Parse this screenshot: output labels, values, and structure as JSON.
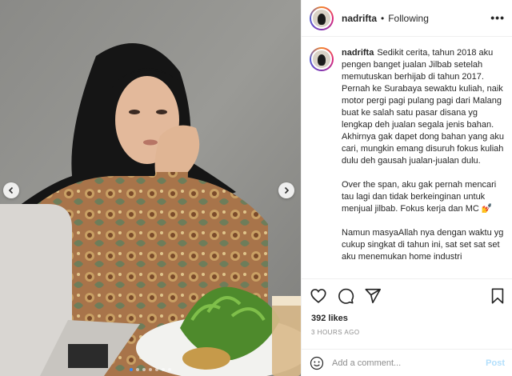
{
  "post": {
    "username": "nadrifta",
    "separator": "•",
    "follow_status": "Following",
    "more_icon": "more-horizontal-icon",
    "caption_paragraphs": [
      "Sedikit cerita, tahun 2018 aku pengen banget jualan Jilbab setelah memutuskan berhijab di tahun 2017. Pernah ke Surabaya sewaktu kuliah, naik motor pergi pagi pulang pagi dari Malang buat ke salah satu pasar disana yg lengkap deh jualan segala jenis bahan. Akhirnya gak dapet dong bahan yang aku cari, mungkin emang disuruh fokus kuliah dulu deh gausah jualan-jualan dulu.",
      "Over the span, aku gak pernah mencari tau lagi dan tidak berkeinginan untuk menjual jilbab. Fokus kerja dan MC 💅",
      "Namun masyaAllah nya dengan waktu yg cukup singkat di tahun ini, sat set sat set aku menemukan home industri"
    ],
    "likes": "392 likes",
    "timestamp": "3 HOURS AGO",
    "comment_placeholder": "Add a comment...",
    "post_label": "Post",
    "carousel": {
      "slide_count": 7,
      "active_index": 0
    }
  },
  "colors": {
    "post_button": "#b2dffc",
    "active_dot": "#3a8bf0",
    "secondary_text": "#8e8e8e"
  }
}
